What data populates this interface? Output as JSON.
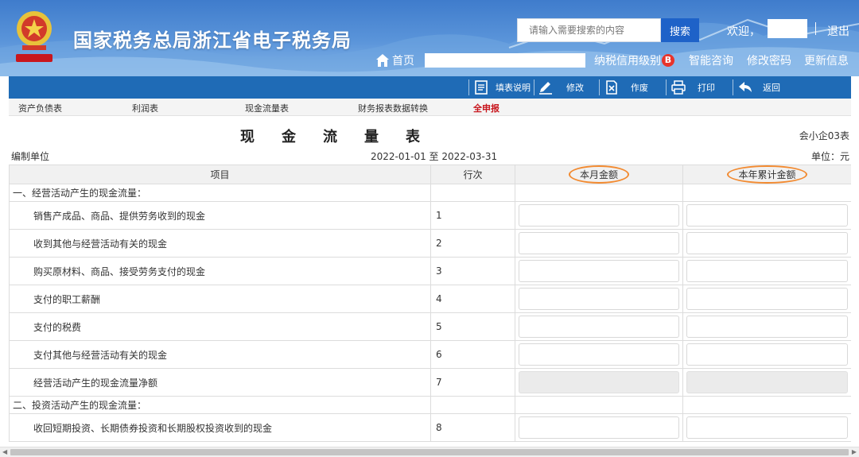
{
  "header": {
    "site_title": "国家税务总局浙江省电子税务局",
    "search_placeholder": "请输入需要搜索的内容",
    "search_label": "搜索",
    "welcome": "欢迎，",
    "logout": "退出",
    "home": "首页",
    "credit_label": "纳税信用级别",
    "credit_grade": "B",
    "nav": [
      "智能咨询",
      "修改密码",
      "更新信息"
    ]
  },
  "toolbar": {
    "guide": "填表说明",
    "edit": "修改",
    "void": "作废",
    "print": "打印",
    "back": "返回"
  },
  "tabs": [
    {
      "label": "资产负债表",
      "active": false
    },
    {
      "label": "利润表",
      "active": false
    },
    {
      "label": "现金流量表",
      "active": false
    },
    {
      "label": "财务报表数据转换",
      "active": false
    },
    {
      "label": "全申报",
      "active": true
    }
  ],
  "report": {
    "title": "现金流量表",
    "form_code": "会小企03表",
    "compiler_label": "编制单位",
    "period": "2022-01-01 至 2022-03-31",
    "unit": "单位：元"
  },
  "table": {
    "headers": {
      "item": "项目",
      "line_no": "行次",
      "month_amount": "本月金额",
      "ytd_amount": "本年累计金额"
    },
    "rows": [
      {
        "type": "section",
        "item": "一、经营活动产生的现金流量："
      },
      {
        "type": "line",
        "item": "销售产成品、商品、提供劳务收到的现金",
        "no": "1",
        "readonly": false
      },
      {
        "type": "line",
        "item": "收到其他与经营活动有关的现金",
        "no": "2",
        "readonly": false
      },
      {
        "type": "line",
        "item": "购买原材料、商品、接受劳务支付的现金",
        "no": "3",
        "readonly": false
      },
      {
        "type": "line",
        "item": "支付的职工薪酬",
        "no": "4",
        "readonly": false
      },
      {
        "type": "line",
        "item": "支付的税费",
        "no": "5",
        "readonly": false
      },
      {
        "type": "line",
        "item": "支付其他与经营活动有关的现金",
        "no": "6",
        "readonly": false
      },
      {
        "type": "line",
        "item": "经营活动产生的现金流量净额",
        "no": "7",
        "readonly": true
      },
      {
        "type": "section",
        "item": "二、投资活动产生的现金流量："
      },
      {
        "type": "line",
        "item": "收回短期投资、长期债券投资和长期股权投资收到的现金",
        "no": "8",
        "readonly": false
      }
    ]
  },
  "colors": {
    "toolbar_bg": "#1f6bb6",
    "search_button": "#1e62c8",
    "active_tab": "#c8161d",
    "header_highlight": "#f28a30",
    "credit_badge": "#e8342b"
  }
}
